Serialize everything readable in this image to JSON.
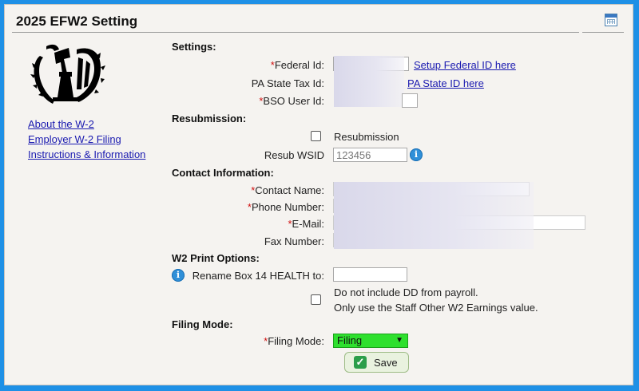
{
  "header": {
    "title": "2025 EFW2 Setting",
    "calendar_icon": "calendar-icon"
  },
  "sidebar": {
    "logo_icon": "irs-eagle-logo",
    "links": [
      "About the W-2",
      "Employer W-2 Filing",
      "Instructions & Information"
    ]
  },
  "settings": {
    "heading": "Settings:",
    "federal_id_label": "Federal Id:",
    "federal_id_link": "Setup Federal ID here",
    "pa_state_label": "PA State Tax Id:",
    "pa_state_link": "PA State ID here",
    "bso_label": "BSO User Id:"
  },
  "resubmission": {
    "heading": "Resubmission:",
    "checkbox_label": "Resubmission",
    "checked": false,
    "wsid_label": "Resub WSID",
    "wsid_placeholder": "123456"
  },
  "contact": {
    "heading": "Contact Information:",
    "name_label": "Contact Name:",
    "phone_label": "Phone Number:",
    "email_label": "E-Mail:",
    "fax_label": "Fax Number:"
  },
  "print_options": {
    "heading": "W2 Print Options:",
    "rename_label": "Rename Box 14 HEALTH to:",
    "rename_value": "",
    "dd_line1": "Do not include DD from payroll.",
    "dd_line2": "Only use the Staff Other W2 Earnings value.",
    "dd_checked": false
  },
  "filing": {
    "heading": "Filing Mode:",
    "mode_label": "Filing Mode:",
    "mode_value": "Filing",
    "mode_color": "#2ee02e"
  },
  "save_label": "Save",
  "required_marker": "*"
}
